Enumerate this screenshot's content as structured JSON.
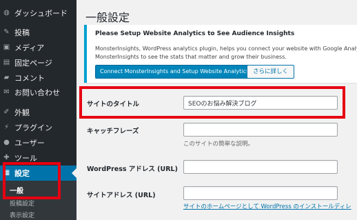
{
  "sidebar": {
    "items": [
      {
        "label": "ダッシュボード",
        "icon": "dashboard-icon",
        "glyph": "◍"
      },
      {
        "label": "投稿",
        "icon": "pin-icon",
        "glyph": "✎"
      },
      {
        "label": "メディア",
        "icon": "media-icon",
        "glyph": "▣"
      },
      {
        "label": "固定ページ",
        "icon": "page-icon",
        "glyph": "▤"
      },
      {
        "label": "コメント",
        "icon": "comment-icon",
        "glyph": "▰"
      },
      {
        "label": "お問い合わせ",
        "icon": "mail-icon",
        "glyph": "✉"
      },
      {
        "label": "外観",
        "icon": "brush-icon",
        "glyph": "✐"
      },
      {
        "label": "プラグイン",
        "icon": "plugin-icon",
        "glyph": "⚡"
      },
      {
        "label": "ユーザー",
        "icon": "user-icon",
        "glyph": "●"
      },
      {
        "label": "ツール",
        "icon": "wrench-icon",
        "glyph": "✚"
      },
      {
        "label": "設定",
        "icon": "settings-icon",
        "glyph": "▦"
      }
    ],
    "submenu": [
      {
        "label": "一般"
      },
      {
        "label": "投稿設定"
      },
      {
        "label": "表示設定"
      }
    ]
  },
  "main": {
    "title": "一般設定",
    "notice": {
      "title": "Please Setup Website Analytics to See Audience Insights",
      "line1": "MonsterInsights, WordPress analytics plugin, helps you connect your website with Google Analytics, so y",
      "line2": "MonsterInsights to see the stats that matter and grow their business.",
      "connect_button": "Connect MonsterInsights and Setup Website Analytics",
      "more_button": "さらに詳しく"
    },
    "fields": {
      "site_title": {
        "label": "サイトのタイトル",
        "value": "SEOのお悩み解決ブログ"
      },
      "tagline": {
        "label": "キャッチフレーズ",
        "value": "",
        "description": "このサイトの簡単な説明。"
      },
      "wp_address": {
        "label": "WordPress アドレス (URL)",
        "value": ""
      },
      "site_address": {
        "label": "サイトアドレス (URL)",
        "value": "",
        "description": "サイトのホームページとして WordPress のインストールディレ"
      }
    }
  },
  "colors": {
    "sidebar_bg": "#23282d",
    "accent": "#0073aa",
    "highlight": "#e60012",
    "notice_border": "#00a0d2"
  }
}
